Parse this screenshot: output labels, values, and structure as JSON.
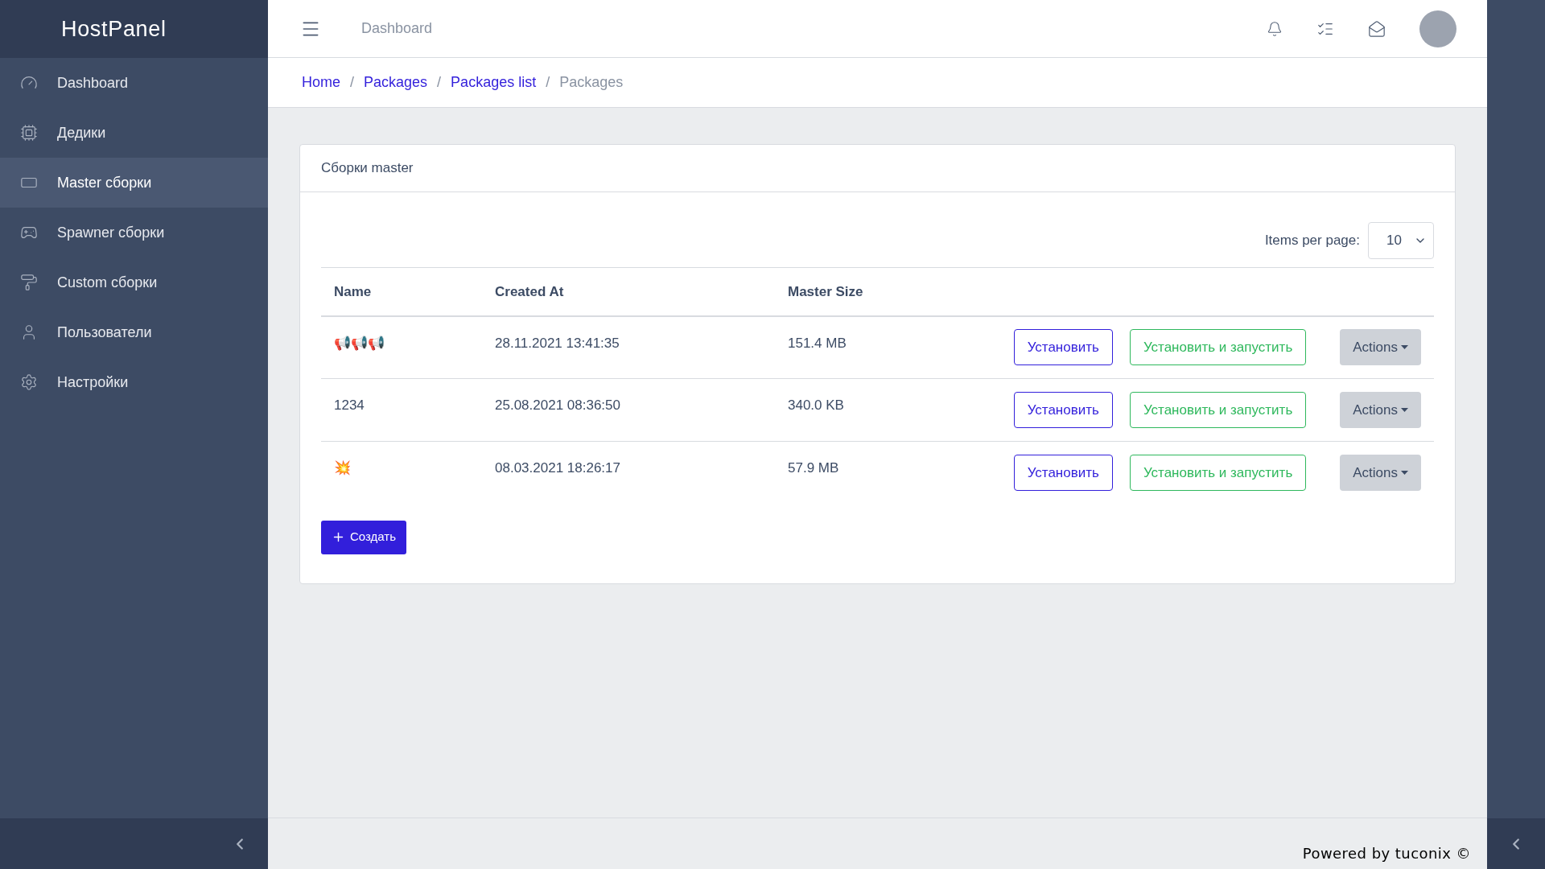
{
  "sidebar": {
    "logo": "HostPanel",
    "items": [
      {
        "label": "Dashboard",
        "selected": false
      },
      {
        "label": "Дедики",
        "selected": false
      },
      {
        "label": "Master сборки",
        "selected": true
      },
      {
        "label": "Spawner сборки",
        "selected": false
      },
      {
        "label": "Custom сборки",
        "selected": false
      },
      {
        "label": "Пользователи",
        "selected": false
      },
      {
        "label": "Настройки",
        "selected": false
      }
    ]
  },
  "header": {
    "title": "Dashboard"
  },
  "breadcrumb_separator": "/",
  "breadcrumbs": [
    {
      "label": "Home",
      "link": true
    },
    {
      "label": "Packages",
      "link": true
    },
    {
      "label": "Packages list",
      "link": true
    },
    {
      "label": "Packages",
      "link": false
    }
  ],
  "card": {
    "title": "Сборки master",
    "items_per_page": {
      "label": "Items per page:",
      "value": "10"
    },
    "table": {
      "columns": [
        "Name",
        "Created At",
        "Master Size"
      ],
      "rows": [
        {
          "name": "📢📢📢",
          "created_at": "28.11.2021 13:41:35",
          "size": "151.4 MB",
          "install": "Установить",
          "install_run": "Установить и запустить",
          "actions": "Actions"
        },
        {
          "name": "1234",
          "created_at": "25.08.2021 08:36:50",
          "size": "340.0 KB",
          "install": "Установить",
          "install_run": "Установить и запустить",
          "actions": "Actions"
        },
        {
          "name": "💥",
          "created_at": "08.03.2021 18:26:17",
          "size": "57.9 MB",
          "install": "Установить",
          "install_run": "Установить и запустить",
          "actions": "Actions"
        }
      ]
    },
    "create_button": "Создать"
  },
  "footer": {
    "text": "Powered by tuconix ©"
  }
}
